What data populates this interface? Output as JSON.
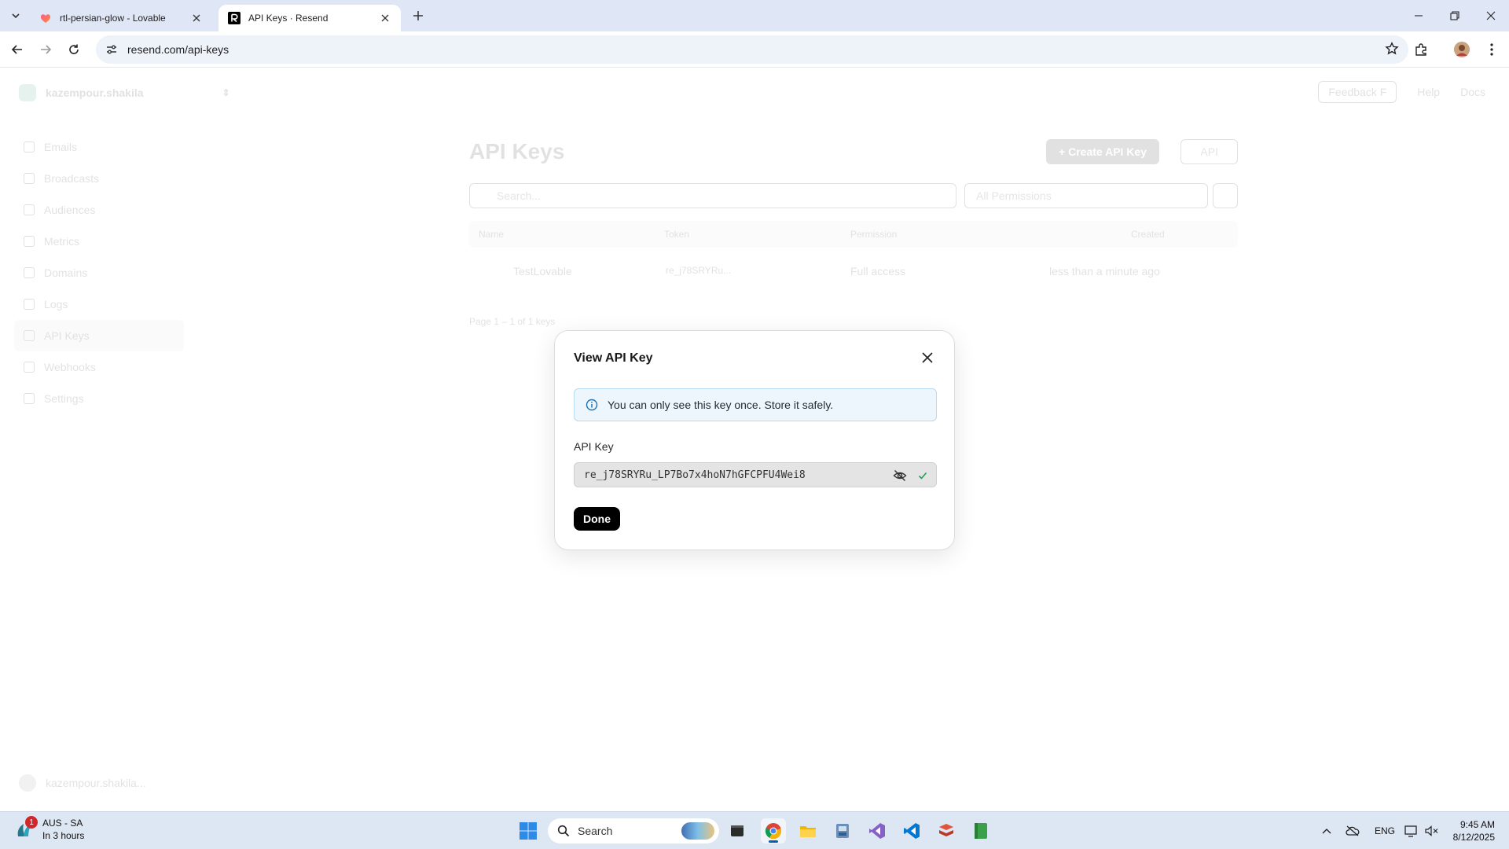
{
  "browser": {
    "tabs": [
      {
        "title": "rtl-persian-glow - Lovable",
        "active": false
      },
      {
        "title": "API Keys · Resend",
        "active": true
      }
    ],
    "url": "resend.com/api-keys"
  },
  "page": {
    "team_name": "kazempour.shakila",
    "nav": [
      "Emails",
      "Broadcasts",
      "Audiences",
      "Metrics",
      "Domains",
      "Logs",
      "API Keys",
      "Webhooks",
      "Settings"
    ],
    "current_nav": "API Keys",
    "user_name": "kazempour.shakila...",
    "header_links": {
      "feedback": "Feedback",
      "feedback_key": "F",
      "help": "Help",
      "docs": "Docs"
    },
    "title": "API Keys",
    "create_button": "+ Create API Key",
    "api_button": "API",
    "search_placeholder": "Search...",
    "permissions_filter": "All Permissions",
    "table": {
      "columns": [
        "Name",
        "Token",
        "Permission",
        "Created"
      ],
      "rows": [
        {
          "name": "TestLovable",
          "token": "re_j78SRYRu...",
          "permission": "Full access",
          "created": "less than a minute ago"
        }
      ]
    },
    "pager": "Page 1 – 1 of 1 keys"
  },
  "modal": {
    "title": "View API Key",
    "notice": "You can only see this key once. Store it safely.",
    "field_label": "API Key",
    "api_key": "re_j78SRYRu_LP7Bo7x4hoN7hGFCPFU4Wei8",
    "done_label": "Done"
  },
  "taskbar": {
    "weather_badge": "1",
    "weather_line1": "AUS - SA",
    "weather_line2": "In 3 hours",
    "search_label": "Search",
    "lang": "ENG",
    "time": "9:45 AM",
    "date": "8/12/2025"
  },
  "colors": {
    "notice_bg": "#edf6fc",
    "notice_border": "#b6dbf3",
    "info_icon": "#1a73b8",
    "check_icon": "#1f9d55",
    "done_button": "#000000"
  }
}
